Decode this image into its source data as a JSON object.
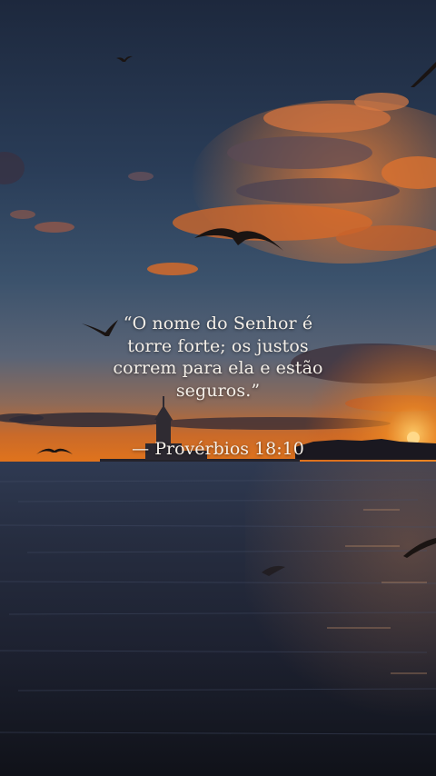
{
  "quote": {
    "lines": [
      "“O nome do Senhor é",
      "torre forte; os justos",
      "correm para ela e estão",
      "seguros.”"
    ],
    "reference": "— Provérbios 18:10"
  }
}
